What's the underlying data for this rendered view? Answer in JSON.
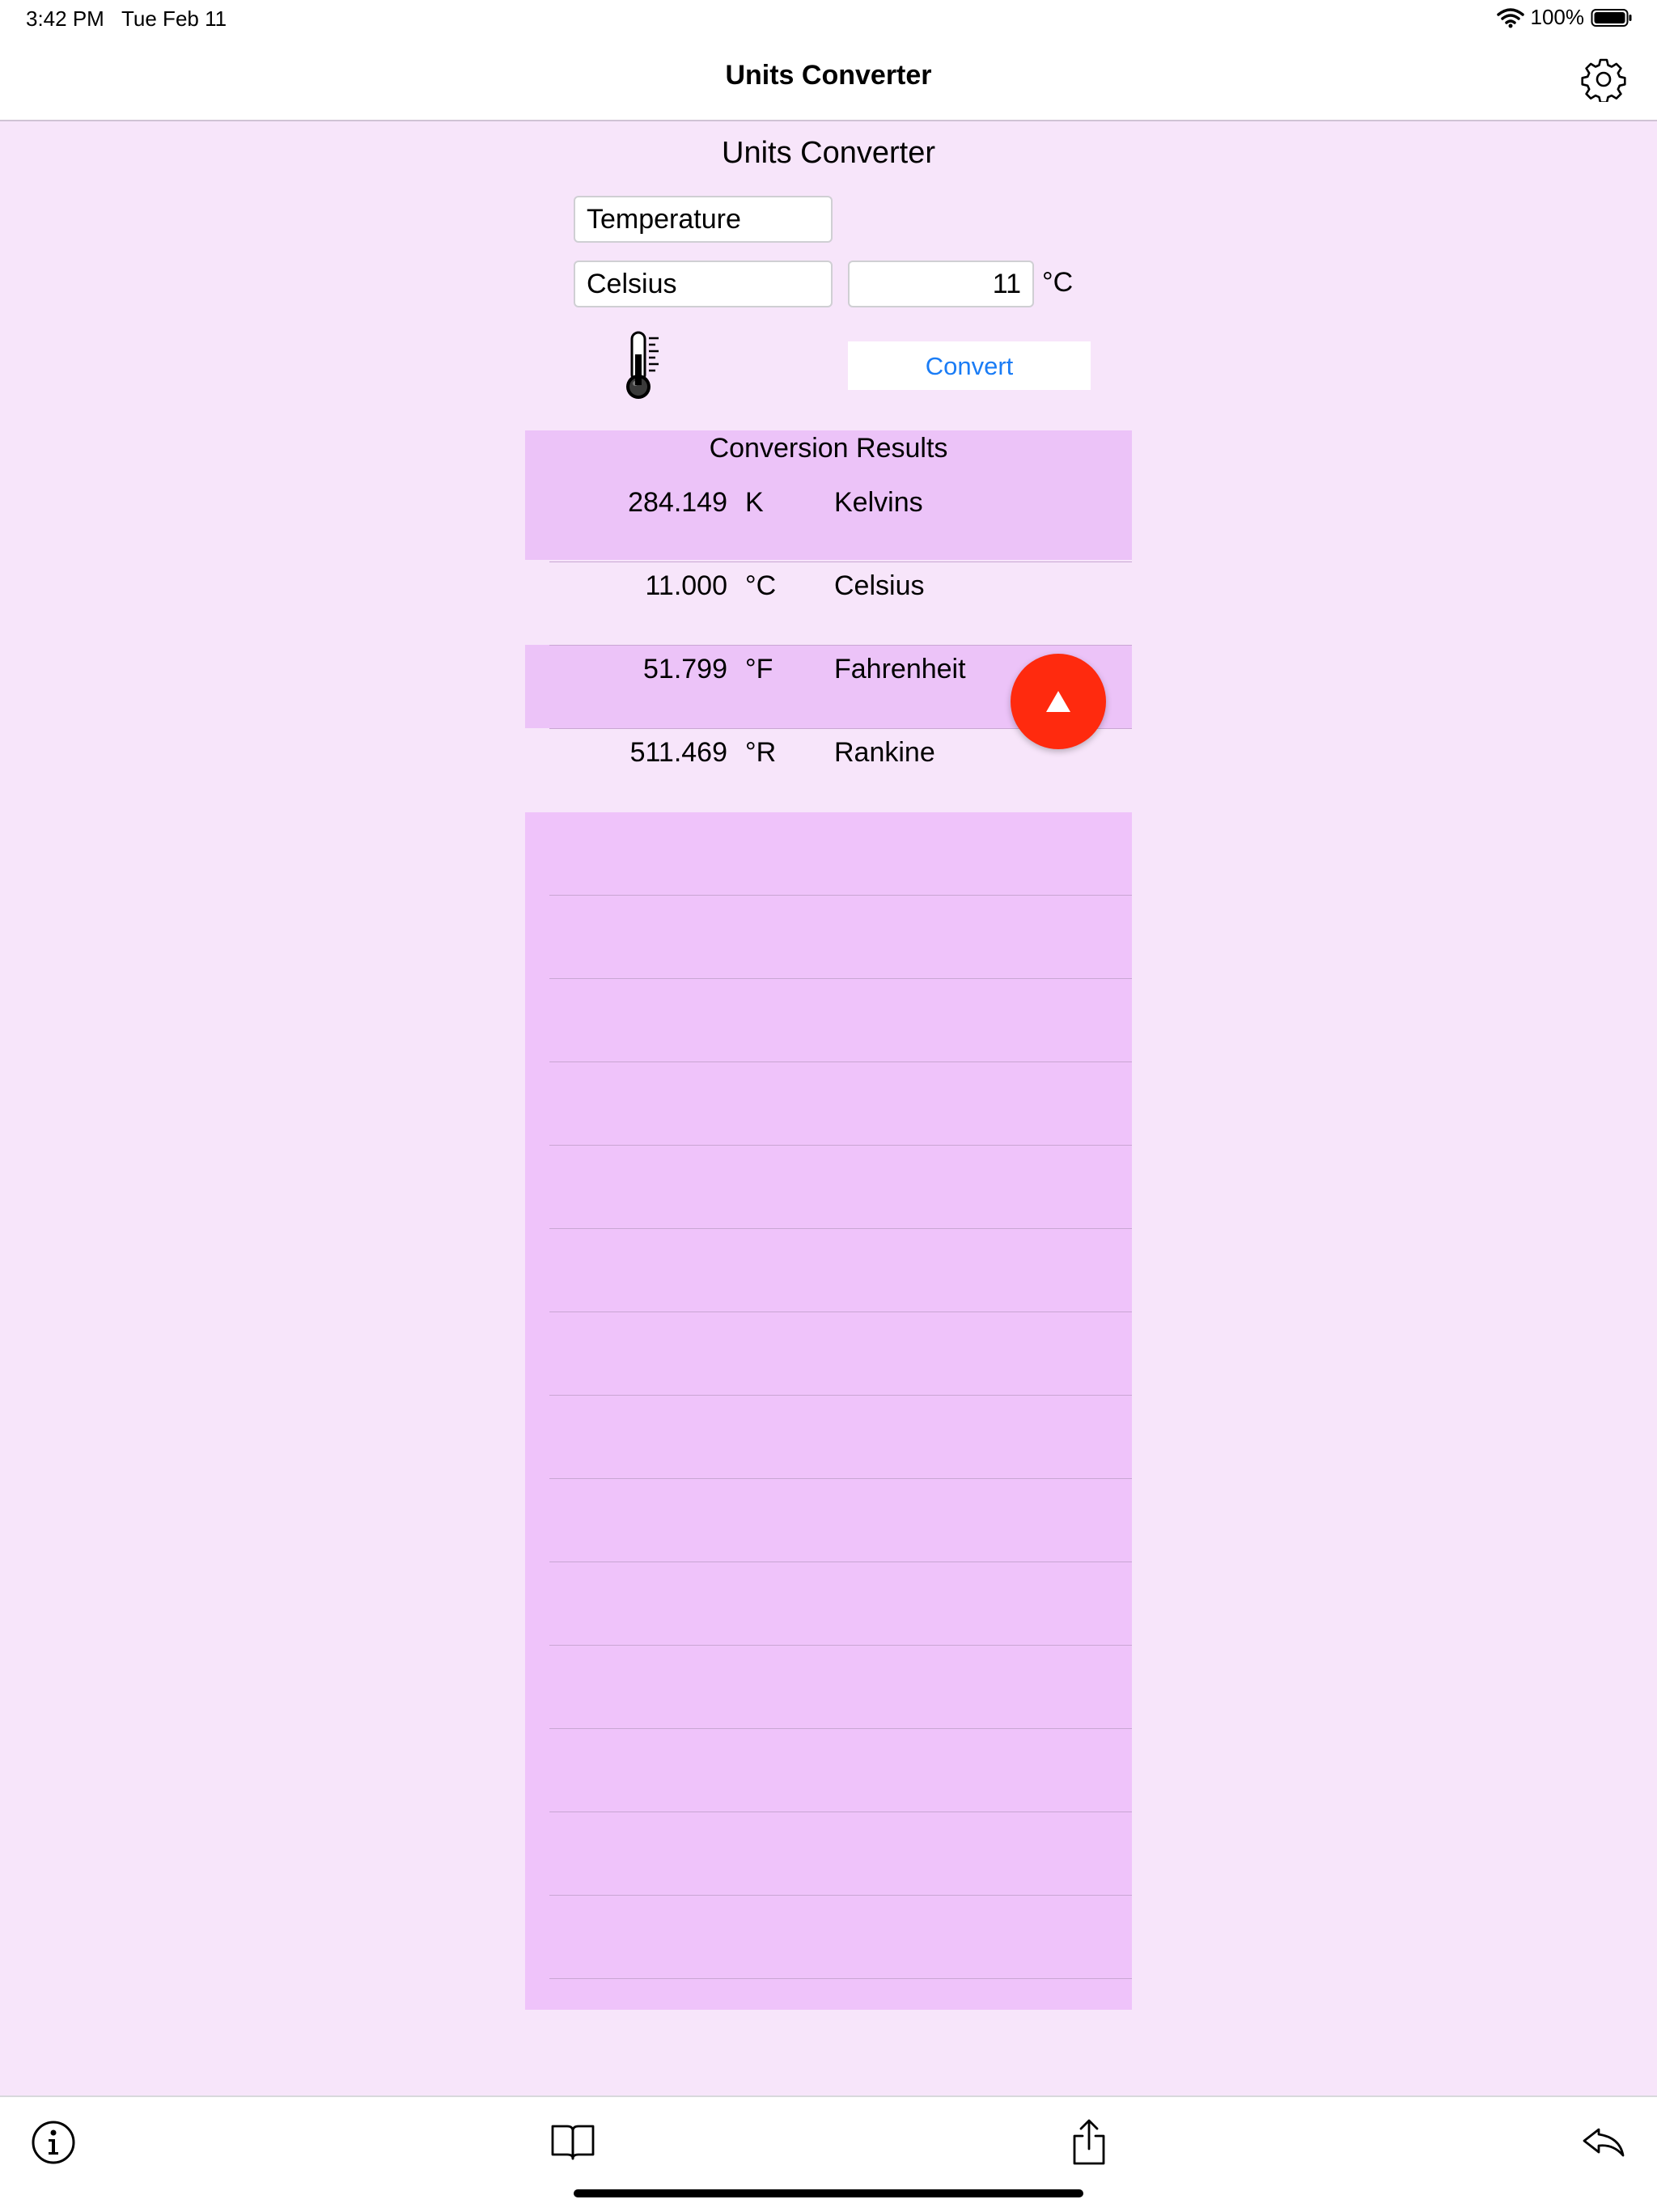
{
  "status_bar": {
    "time": "3:42 PM",
    "date": "Tue Feb 11",
    "battery": "100%"
  },
  "nav": {
    "title": "Units Converter",
    "settings_icon": "gear-icon"
  },
  "converter": {
    "title": "Units Converter",
    "category": "Temperature",
    "from_unit": "Celsius",
    "input_value": "11",
    "unit_symbol": "°C",
    "category_icon": "thermometer-icon",
    "convert_label": "Convert"
  },
  "results": {
    "heading": "Conversion Results",
    "rows": [
      {
        "value": "284.149",
        "symbol": "K",
        "name": "Kelvins"
      },
      {
        "value": "11.000",
        "symbol": "°C",
        "name": "Celsius"
      },
      {
        "value": "51.799",
        "symbol": "°F",
        "name": "Fahrenheit"
      },
      {
        "value": "511.469",
        "symbol": "°R",
        "name": "Rankine"
      }
    ]
  },
  "fab_icon": "arrow-up-icon",
  "toolbar": {
    "items": [
      "info-icon",
      "book-icon",
      "share-icon",
      "reply-icon"
    ]
  },
  "colors": {
    "background": "#f7e5fa",
    "results_highlight": "#ecc3f8",
    "accent": "#1a7cf5",
    "fab": "#ff2a0e"
  }
}
